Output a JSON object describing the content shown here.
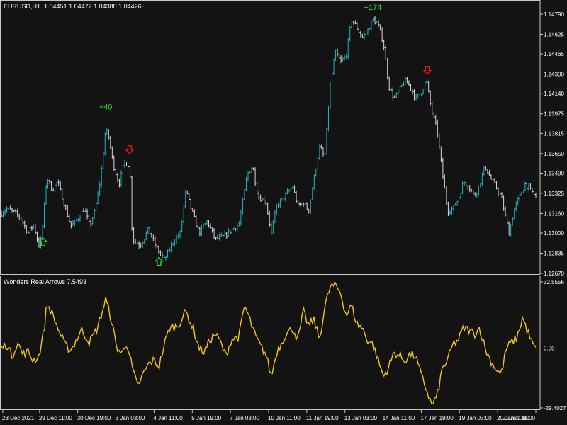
{
  "header": {
    "symbol": "EURUSD,H1",
    "ohlc": "1.04451 1.04472 1.04380 1.04426"
  },
  "indicator": {
    "label": "Wonders Real Arrows 7.5493"
  },
  "colors": {
    "background": "#131313",
    "axis": "#c8c8c8",
    "bar_up": "#1fb5c1",
    "bar_down": "#d8d8d8",
    "indicator_line": "#f3c316",
    "zero_line": "#9a9a9a",
    "buy_arrow": "#2ee52e",
    "sell_arrow": "#e21818",
    "profit_text": "#2ee52e"
  },
  "chart_data": [
    {
      "type": "bar",
      "y_ticks": [
        "1.14790",
        "1.14625",
        "1.14465",
        "1.14300",
        "1.14140",
        "1.13975",
        "1.13815",
        "1.13650",
        "1.13490",
        "1.13325",
        "1.13160",
        "1.13000",
        "1.12835",
        "1.12670"
      ],
      "ylim": [
        1.1267,
        1.1479
      ],
      "points": [
        [
          0,
          1.1316
        ],
        [
          0.01,
          1.132
        ],
        [
          0.02,
          1.1318
        ],
        [
          0.035,
          1.1313
        ],
        [
          0.05,
          1.13
        ],
        [
          0.06,
          1.1307
        ],
        [
          0.07,
          1.129
        ],
        [
          0.075,
          1.1296
        ],
        [
          0.085,
          1.1346
        ],
        [
          0.095,
          1.1335
        ],
        [
          0.105,
          1.1342
        ],
        [
          0.12,
          1.132
        ],
        [
          0.13,
          1.1306
        ],
        [
          0.14,
          1.131
        ],
        [
          0.155,
          1.132
        ],
        [
          0.165,
          1.1306
        ],
        [
          0.175,
          1.1318
        ],
        [
          0.185,
          1.1343
        ],
        [
          0.195,
          1.1385
        ],
        [
          0.2,
          1.138
        ],
        [
          0.21,
          1.1355
        ],
        [
          0.22,
          1.134
        ],
        [
          0.23,
          1.1358
        ],
        [
          0.24,
          1.1355
        ],
        [
          0.245,
          1.1295
        ],
        [
          0.26,
          1.129
        ],
        [
          0.275,
          1.1303
        ],
        [
          0.29,
          1.1288
        ],
        [
          0.305,
          1.1278
        ],
        [
          0.32,
          1.1292
        ],
        [
          0.335,
          1.13
        ],
        [
          0.345,
          1.1335
        ],
        [
          0.355,
          1.132
        ],
        [
          0.37,
          1.13
        ],
        [
          0.385,
          1.131
        ],
        [
          0.4,
          1.1295
        ],
        [
          0.415,
          1.1297
        ],
        [
          0.43,
          1.1302
        ],
        [
          0.445,
          1.1308
        ],
        [
          0.46,
          1.1348
        ],
        [
          0.47,
          1.1355
        ],
        [
          0.48,
          1.133
        ],
        [
          0.495,
          1.1325
        ],
        [
          0.505,
          1.13
        ],
        [
          0.515,
          1.1322
        ],
        [
          0.53,
          1.133
        ],
        [
          0.545,
          1.1338
        ],
        [
          0.555,
          1.1322
        ],
        [
          0.565,
          1.1325
        ],
        [
          0.575,
          1.1318
        ],
        [
          0.585,
          1.1345
        ],
        [
          0.595,
          1.137
        ],
        [
          0.605,
          1.1362
        ],
        [
          0.615,
          1.142
        ],
        [
          0.625,
          1.1448
        ],
        [
          0.635,
          1.144
        ],
        [
          0.645,
          1.1445
        ],
        [
          0.655,
          1.1475
        ],
        [
          0.665,
          1.1468
        ],
        [
          0.675,
          1.146
        ],
        [
          0.685,
          1.1465
        ],
        [
          0.695,
          1.1475
        ],
        [
          0.705,
          1.147
        ],
        [
          0.715,
          1.1455
        ],
        [
          0.725,
          1.142
        ],
        [
          0.735,
          1.141
        ],
        [
          0.745,
          1.1417
        ],
        [
          0.755,
          1.1425
        ],
        [
          0.765,
          1.142
        ],
        [
          0.775,
          1.141
        ],
        [
          0.785,
          1.1415
        ],
        [
          0.795,
          1.1425
        ],
        [
          0.805,
          1.14
        ],
        [
          0.815,
          1.1385
        ],
        [
          0.825,
          1.135
        ],
        [
          0.835,
          1.1318
        ],
        [
          0.845,
          1.132
        ],
        [
          0.855,
          1.1328
        ],
        [
          0.865,
          1.1342
        ],
        [
          0.875,
          1.1338
        ],
        [
          0.885,
          1.133
        ],
        [
          0.895,
          1.134
        ],
        [
          0.905,
          1.1355
        ],
        [
          0.915,
          1.1345
        ],
        [
          0.925,
          1.1338
        ],
        [
          0.935,
          1.133
        ],
        [
          0.945,
          1.131
        ],
        [
          0.95,
          1.13
        ],
        [
          0.96,
          1.132
        ],
        [
          0.97,
          1.133
        ],
        [
          0.98,
          1.134
        ],
        [
          0.99,
          1.1335
        ],
        [
          1.0,
          1.133
        ]
      ],
      "annotations": [
        {
          "kind": "buy",
          "pos": 0.078,
          "price": 1.1296
        },
        {
          "kind": "profit",
          "label": "+40",
          "pos": 0.195,
          "price": 1.13975
        },
        {
          "kind": "sell",
          "pos": 0.24,
          "price": 1.1365
        },
        {
          "kind": "buy",
          "pos": 0.295,
          "price": 1.128
        },
        {
          "kind": "profit",
          "label": "+174",
          "pos": 0.695,
          "price": 1.1479
        },
        {
          "kind": "sell",
          "pos": 0.797,
          "price": 1.143
        }
      ]
    },
    {
      "type": "line",
      "name": "Wonders Real Arrows",
      "y_ticks": [
        "32.5556",
        "0.00",
        "-29.4027"
      ],
      "ylim": [
        -29.4027,
        32.5556
      ],
      "points": [
        [
          0,
          0
        ],
        [
          0.01,
          2
        ],
        [
          0.02,
          -4
        ],
        [
          0.03,
          3
        ],
        [
          0.04,
          -3
        ],
        [
          0.05,
          -2
        ],
        [
          0.06,
          -6
        ],
        [
          0.07,
          -4
        ],
        [
          0.08,
          9
        ],
        [
          0.085,
          22
        ],
        [
          0.095,
          17
        ],
        [
          0.11,
          7
        ],
        [
          0.12,
          1
        ],
        [
          0.13,
          -1
        ],
        [
          0.14,
          4
        ],
        [
          0.15,
          9
        ],
        [
          0.165,
          3
        ],
        [
          0.18,
          10
        ],
        [
          0.195,
          24
        ],
        [
          0.205,
          15
        ],
        [
          0.215,
          1
        ],
        [
          0.225,
          -3
        ],
        [
          0.235,
          3
        ],
        [
          0.245,
          -10
        ],
        [
          0.255,
          -19
        ],
        [
          0.265,
          -13
        ],
        [
          0.275,
          -8
        ],
        [
          0.285,
          -6
        ],
        [
          0.295,
          -9
        ],
        [
          0.305,
          2
        ],
        [
          0.315,
          10
        ],
        [
          0.33,
          11
        ],
        [
          0.345,
          18
        ],
        [
          0.36,
          9
        ],
        [
          0.37,
          0
        ],
        [
          0.38,
          -2
        ],
        [
          0.39,
          4
        ],
        [
          0.4,
          7
        ],
        [
          0.41,
          3
        ],
        [
          0.42,
          -4
        ],
        [
          0.43,
          4
        ],
        [
          0.445,
          6
        ],
        [
          0.455,
          21
        ],
        [
          0.465,
          14
        ],
        [
          0.475,
          6
        ],
        [
          0.485,
          1
        ],
        [
          0.495,
          -3
        ],
        [
          0.505,
          -14
        ],
        [
          0.515,
          -2
        ],
        [
          0.53,
          6
        ],
        [
          0.545,
          10
        ],
        [
          0.555,
          4
        ],
        [
          0.565,
          18
        ],
        [
          0.575,
          11
        ],
        [
          0.585,
          14
        ],
        [
          0.595,
          4
        ],
        [
          0.605,
          20
        ],
        [
          0.615,
          30
        ],
        [
          0.625,
          31
        ],
        [
          0.635,
          27
        ],
        [
          0.645,
          16
        ],
        [
          0.655,
          21
        ],
        [
          0.665,
          12
        ],
        [
          0.675,
          10
        ],
        [
          0.685,
          4
        ],
        [
          0.695,
          2
        ],
        [
          0.705,
          -6
        ],
        [
          0.715,
          -14
        ],
        [
          0.725,
          -9
        ],
        [
          0.735,
          -2
        ],
        [
          0.745,
          -4
        ],
        [
          0.755,
          -6
        ],
        [
          0.765,
          -3
        ],
        [
          0.775,
          -4
        ],
        [
          0.785,
          -13
        ],
        [
          0.795,
          -20
        ],
        [
          0.805,
          -28
        ],
        [
          0.815,
          -24
        ],
        [
          0.825,
          -10
        ],
        [
          0.835,
          -6
        ],
        [
          0.845,
          2
        ],
        [
          0.855,
          4
        ],
        [
          0.865,
          10
        ],
        [
          0.875,
          9
        ],
        [
          0.885,
          7
        ],
        [
          0.895,
          10
        ],
        [
          0.905,
          0
        ],
        [
          0.915,
          -6
        ],
        [
          0.925,
          -10
        ],
        [
          0.935,
          -13
        ],
        [
          0.945,
          0
        ],
        [
          0.955,
          3
        ],
        [
          0.965,
          5
        ],
        [
          0.975,
          15
        ],
        [
          0.985,
          8
        ],
        [
          0.995,
          1
        ],
        [
          1.0,
          0
        ]
      ]
    }
  ],
  "x_labels": [
    "28 Dec 2021",
    "29 Dec 11:00",
    "30 Dec 19:00",
    "3 Jan 03:00",
    "4 Jan 11:00",
    "5 Jan 19:00",
    "7 Jan 03:00",
    "10 Jan 11:00",
    "11 Jan 19:00",
    "13 Jan 03:00",
    "14 Jan 11:00",
    "17 Jan 19:00",
    "19 Jan 03:00",
    "20 Jan 11:00",
    "21 Jan 19:00"
  ]
}
